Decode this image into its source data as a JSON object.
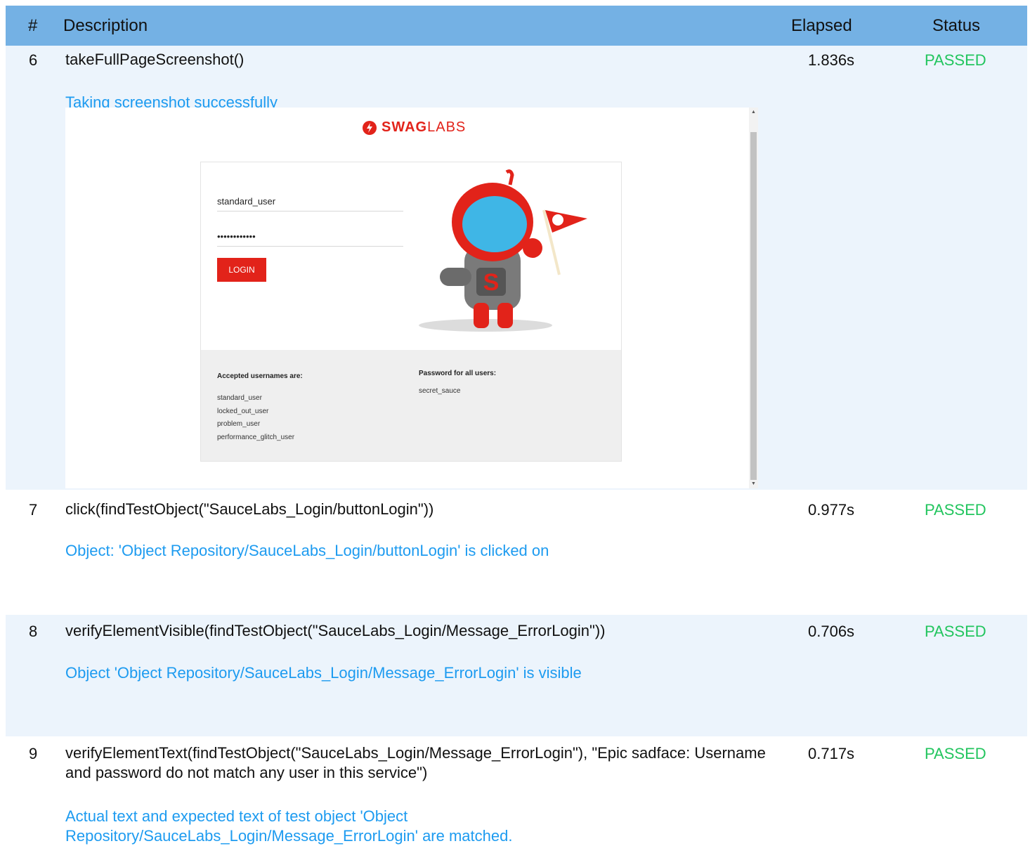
{
  "header": {
    "num": "#",
    "description": "Description",
    "elapsed": "Elapsed",
    "status": "Status"
  },
  "rows": [
    {
      "num": "6",
      "description": "takeFullPageScreenshot()",
      "elapsed": "1.836s",
      "status": "PASSED",
      "message": "Taking screenshot successfully"
    },
    {
      "num": "7",
      "description": "click(findTestObject(\"SauceLabs_Login/buttonLogin\"))",
      "elapsed": "0.977s",
      "status": "PASSED",
      "message": "Object: 'Object Repository/SauceLabs_Login/buttonLogin' is clicked on"
    },
    {
      "num": "8",
      "description": "verifyElementVisible(findTestObject(\"SauceLabs_Login/Message_ErrorLogin\"))",
      "elapsed": "0.706s",
      "status": "PASSED",
      "message": "Object 'Object Repository/SauceLabs_Login/Message_ErrorLogin' is visible"
    },
    {
      "num": "9",
      "description": "verifyElementText(findTestObject(\"SauceLabs_Login/Message_ErrorLogin\"), \"Epic sadface: Username and password do not match any user in this service\")",
      "elapsed": "0.717s",
      "status": "PASSED",
      "message": "Actual text and expected text of test object 'Object Repository/SauceLabs_Login/Message_ErrorLogin' are matched."
    }
  ],
  "screenshot": {
    "logo_bold": "SWAG",
    "logo_light": "LABS",
    "username_value": "standard_user",
    "password_value": "••••••••••••",
    "login_button": "LOGIN",
    "accepted_heading": "Accepted usernames are:",
    "usernames": [
      "standard_user",
      "locked_out_user",
      "problem_user",
      "performance_glitch_user"
    ],
    "password_heading": "Password for all users:",
    "password_hint": "secret_sauce"
  },
  "colors": {
    "header_bg": "#74b1e4",
    "row_alt_bg": "#ecf4fc",
    "passed": "#22c55e",
    "message": "#1d9bf0",
    "brand_red": "#e2231a"
  }
}
